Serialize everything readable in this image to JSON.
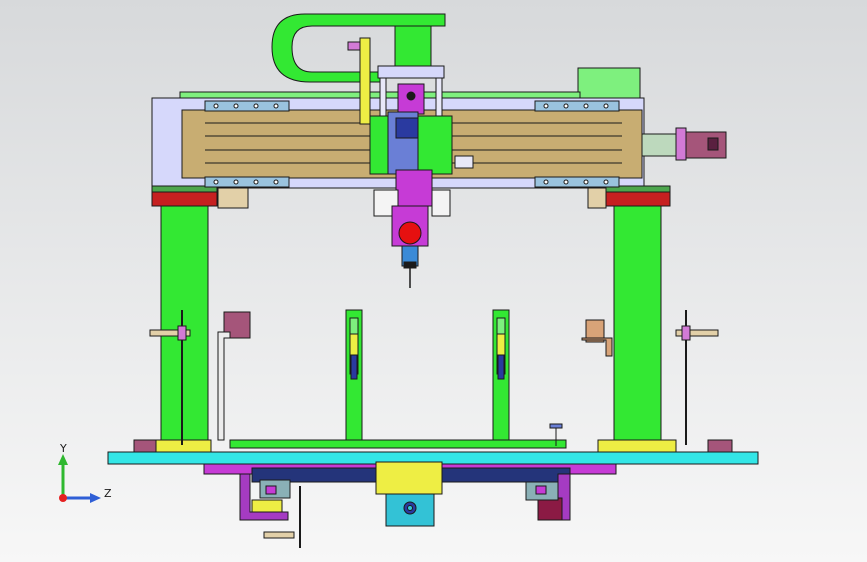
{
  "viewport": {
    "view": "front",
    "background": [
      "#d7d9db",
      "#f7f7f7"
    ]
  },
  "triad": {
    "axes": [
      {
        "label": "Y",
        "color": "#2fb82f"
      },
      {
        "label": "Z",
        "color": "#2f5fd6"
      }
    ],
    "origin_color": "#e52020"
  },
  "palette": {
    "outline": "#1a1a1a",
    "frame_green": "#33e833",
    "gantry_plate": "#d6d8fb",
    "rail_tan": "#c8ad72",
    "cable_green": "#33e833",
    "block_blue": "#9ac3de",
    "carriage_magenta": "#c63bd6",
    "red_strip": "#c62020",
    "yellow_pad": "#eeee44",
    "base_cyan": "#33e6e6",
    "navy_beam": "#24347a",
    "purple_leg": "#a53bc2",
    "motor_purple": "#a5557a",
    "valve_red": "#e61010",
    "bracket_orange": "#d8a378"
  }
}
